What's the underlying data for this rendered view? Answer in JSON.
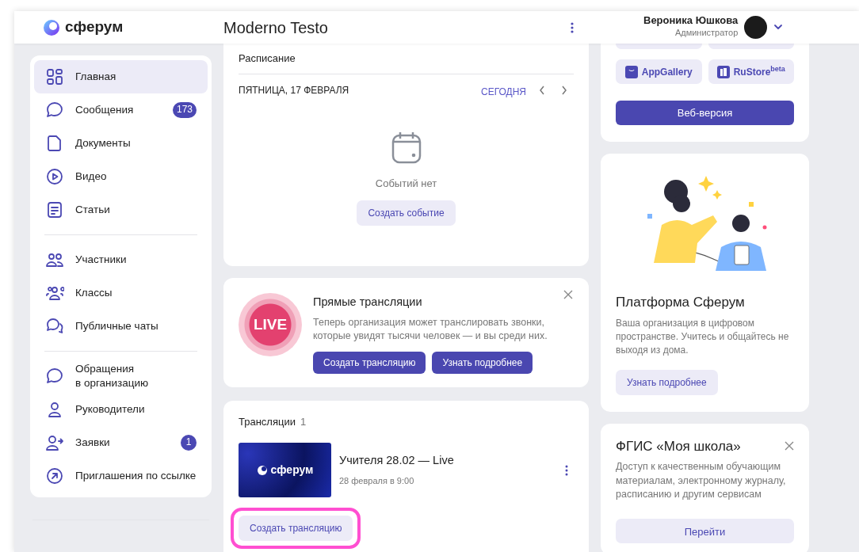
{
  "header": {
    "logo_text": "сферум",
    "title": "Moderno Testo",
    "user": {
      "name": "Вероника Юшкова",
      "role": "Администратор"
    }
  },
  "sidebar": {
    "groups": [
      {
        "items": [
          {
            "label": "Главная",
            "selected": true
          },
          {
            "label": "Сообщения",
            "selected": false,
            "badge": "173"
          },
          {
            "label": "Документы",
            "selected": false
          },
          {
            "label": "Видео",
            "selected": false
          },
          {
            "label": "Статьи",
            "selected": false
          }
        ]
      },
      {
        "items": [
          {
            "label": "Участники",
            "selected": false
          },
          {
            "label": "Классы",
            "selected": false
          },
          {
            "label": "Публичные чаты",
            "selected": false
          }
        ]
      },
      {
        "items": [
          {
            "label": "Обращения\nв организацию",
            "selected": false
          },
          {
            "label": "Руководители",
            "selected": false
          },
          {
            "label": "Заявки",
            "selected": false,
            "badge": "1"
          },
          {
            "label": "Приглашения по ссылке",
            "selected": false
          }
        ]
      }
    ]
  },
  "schedule": {
    "title": "Расписание",
    "date": "ПЯТНИЦА, 17 ФЕВРАЛЯ",
    "today": "СЕГОДНЯ",
    "empty_text": "Событий нет",
    "button": "Создать событие"
  },
  "live_promo": {
    "badge": "LIVE",
    "title": "Прямые трансляции",
    "text": "Теперь организация может транслировать звонки, которые увидят тысячи человек — и вы среди них.",
    "buttons": [
      "Создать трансляцию",
      "Узнать подробнее"
    ]
  },
  "broadcasts": {
    "title": "Трансляции",
    "count": "1",
    "items": [
      {
        "thumbnail_text": "сферум",
        "title": "Учителя 28.02 — Live",
        "date": "28 февраля в 9:00"
      }
    ],
    "button": {
      "label": "Создать трансляцию",
      "highlighted": true
    }
  },
  "apps": {
    "stores": [
      "AppGallery",
      "RuStore$^{beta}$"
    ],
    "web_button": "Веб-версия"
  },
  "platform": {
    "title": "Платформа Сферум",
    "text": "Ваша организация в цифровом пространстве. Учитесь и общайтесь не выходя из дома.",
    "button": "Узнать подробнее"
  },
  "school": {
    "title": "ФГИС «Моя школа»",
    "text": "Доступ к качественным обучающим материалам, электронному журналу, расписанию и другим сервисам",
    "button": "Перейти"
  }
}
